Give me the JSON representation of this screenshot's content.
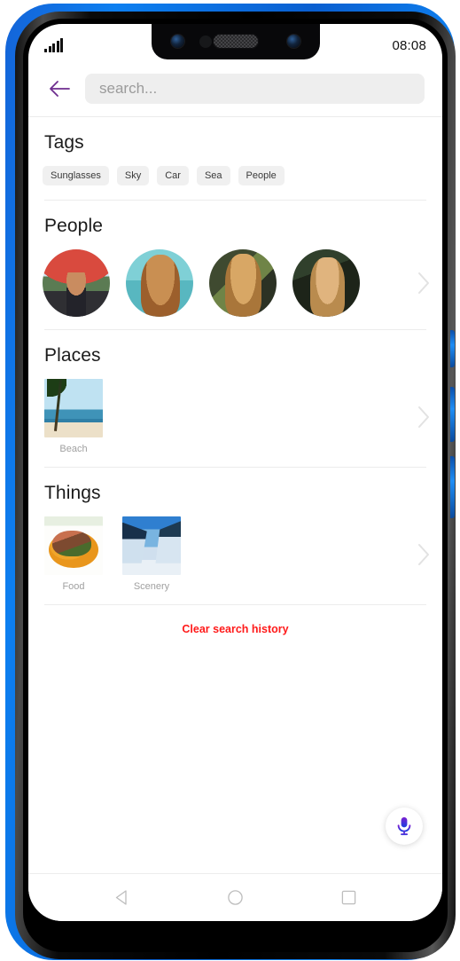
{
  "status_bar": {
    "signal_icon": "signal-bars-icon",
    "clock": "08:08"
  },
  "header": {
    "back_icon": "back-arrow-icon",
    "back_icon_color": "#6d2d8e",
    "search_value": "",
    "search_placeholder": "search..."
  },
  "sections": {
    "tags": {
      "title": "Tags",
      "chips": [
        {
          "label": "Sunglasses"
        },
        {
          "label": "Sky"
        },
        {
          "label": "Car"
        },
        {
          "label": "Sea"
        },
        {
          "label": "People"
        }
      ]
    },
    "people": {
      "title": "People",
      "chevron_icon": "chevron-right-icon",
      "avatars": [
        {
          "name": "person-1-red-umbrella"
        },
        {
          "name": "person-2-curly-hair"
        },
        {
          "name": "person-3-blonde-greenery"
        },
        {
          "name": "person-4-round-glasses"
        }
      ]
    },
    "places": {
      "title": "Places",
      "chevron_icon": "chevron-right-icon",
      "items": [
        {
          "label": "Beach"
        }
      ]
    },
    "things": {
      "title": "Things",
      "chevron_icon": "chevron-right-icon",
      "items": [
        {
          "label": "Food"
        },
        {
          "label": "Scenery"
        }
      ]
    }
  },
  "clear_history": {
    "label": "Clear search history",
    "color": "#ff1a1a"
  },
  "mic_fab": {
    "icon": "microphone-icon",
    "color_top": "#7b1fd1",
    "color_bottom": "#1a3fe0"
  },
  "nav_bar": {
    "back_icon": "nav-back-triangle-icon",
    "home_icon": "nav-home-circle-icon",
    "recents_icon": "nav-recents-square-icon"
  },
  "device": {
    "notch_camera_left": "front-camera-left",
    "notch_camera_right": "front-camera-right",
    "notch_sensor": "proximity-sensor",
    "notch_speaker": "earpiece-speaker",
    "frame_color": "#0d7ff0"
  }
}
